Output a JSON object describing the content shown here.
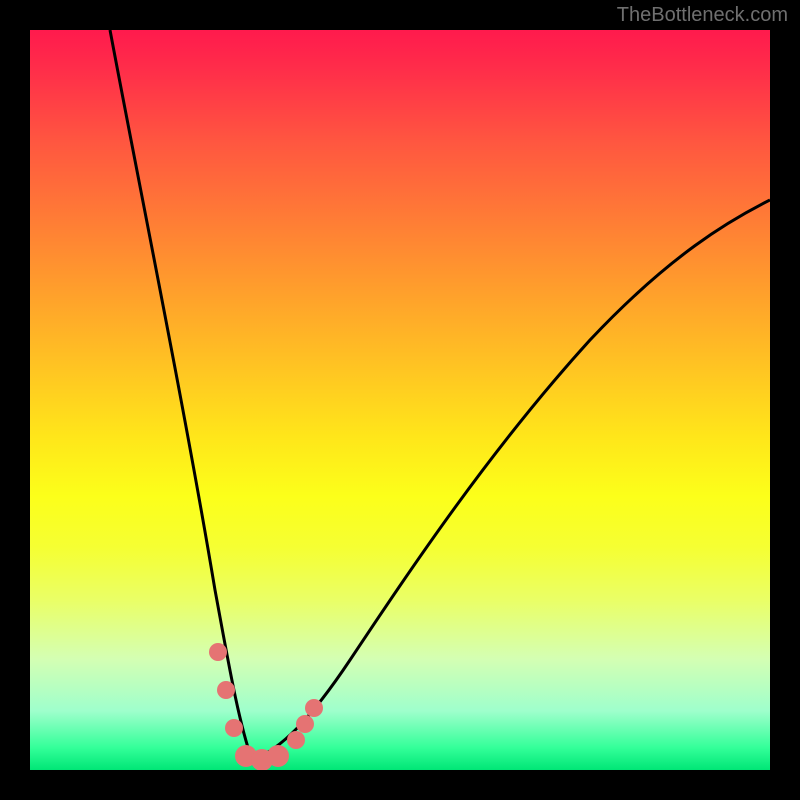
{
  "watermark": "TheBottleneck.com",
  "chart_data": {
    "type": "line",
    "title": "",
    "xlabel": "",
    "ylabel": "",
    "xlim": [
      0,
      100
    ],
    "ylim": [
      0,
      100
    ],
    "note": "Unlabeled V-shaped bottleneck curve over gradient background; minimum near x≈30. Values are estimated from pixel positions.",
    "series": [
      {
        "name": "left-branch",
        "x": [
          11,
          14,
          17,
          20,
          23,
          25,
          27,
          29,
          30
        ],
        "y": [
          100,
          84,
          67,
          50,
          34,
          20,
          10,
          3,
          0
        ]
      },
      {
        "name": "right-branch",
        "x": [
          30,
          34,
          38,
          43,
          50,
          58,
          68,
          80,
          94,
          100
        ],
        "y": [
          0,
          2,
          6,
          13,
          23,
          35,
          48,
          60,
          72,
          77
        ]
      }
    ],
    "markers": [
      {
        "x": 25.5,
        "y": 16
      },
      {
        "x": 26.5,
        "y": 11
      },
      {
        "x": 27.5,
        "y": 6
      },
      {
        "x": 29,
        "y": 1.5
      },
      {
        "x": 31,
        "y": 0.8
      },
      {
        "x": 33,
        "y": 1.2
      },
      {
        "x": 35.5,
        "y": 3.5
      },
      {
        "x": 36.5,
        "y": 5.5
      },
      {
        "x": 38,
        "y": 8
      }
    ],
    "gradient_colors": {
      "top": "#ff1a4d",
      "mid": "#ffe61a",
      "bottom": "#00e676"
    }
  }
}
